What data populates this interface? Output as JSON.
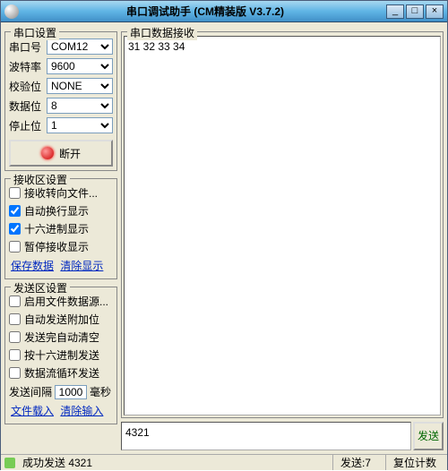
{
  "window": {
    "title": "串口调试助手  (CM精装版 V3.7.2)",
    "min": "_",
    "max": "□",
    "close": "×"
  },
  "port": {
    "legend": "串口设置",
    "com_label": "串口号",
    "com_value": "COM12",
    "baud_label": "波特率",
    "baud_value": "9600",
    "parity_label": "校验位",
    "parity_value": "NONE",
    "data_label": "数据位",
    "data_value": "8",
    "stop_label": "停止位",
    "stop_value": "1",
    "disconnect": "断开"
  },
  "rxset": {
    "legend": "接收区设置",
    "c1": "接收转向文件...",
    "c2": "自动换行显示",
    "c3": "十六进制显示",
    "c4": "暂停接收显示",
    "save": "保存数据",
    "clear": "清除显示"
  },
  "txset": {
    "legend": "发送区设置",
    "c1": "启用文件数据源...",
    "c2": "自动发送附加位",
    "c3": "发送完自动清空",
    "c4": "按十六进制发送",
    "c5": "数据流循环发送",
    "interval_label": "发送间隔",
    "interval_value": "1000",
    "interval_unit": "毫秒",
    "fileload": "文件载入",
    "clear": "清除输入"
  },
  "rx": {
    "legend": "串口数据接收",
    "data": "31 32 33 34"
  },
  "send": {
    "input": "4321",
    "button": "发送"
  },
  "status": {
    "ok": "成功发送 4321",
    "sent_label": "发送:",
    "sent_value": "7",
    "reset": "复位计数"
  }
}
